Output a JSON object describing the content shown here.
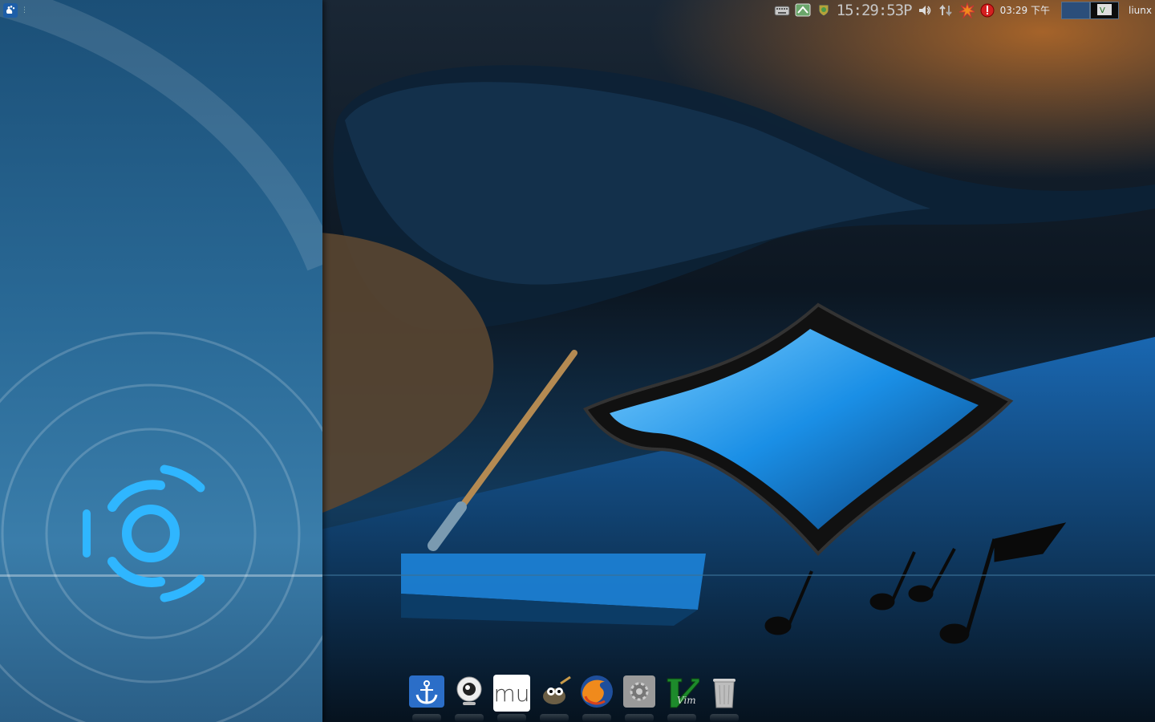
{
  "top_panel": {
    "tray_icons": [
      "keyboard-icon",
      "network-manager-icon",
      "shield-update-icon"
    ],
    "digital_clock": "15:29:53P",
    "status_icons": [
      "volume-icon",
      "network-arrows-icon",
      "starburst-notification-icon",
      "red-alert-gear-icon"
    ],
    "clock_text": "03:29 下午",
    "workspaces": [
      "workspace-1",
      "workspace-2"
    ],
    "username": "liunx"
  },
  "dock": {
    "items": [
      {
        "name": "anchor-launcher",
        "icon": "anchor-icon"
      },
      {
        "name": "webcam-app",
        "icon": "webcam-icon"
      },
      {
        "name": "musescore-app",
        "icon": "mu-icon",
        "label": "mu"
      },
      {
        "name": "gimp-app",
        "icon": "gimp-icon"
      },
      {
        "name": "firefox-app",
        "icon": "firefox-icon"
      },
      {
        "name": "system-settings",
        "icon": "settings-gear-icon"
      },
      {
        "name": "vim-app",
        "icon": "vim-icon",
        "label": "Vim"
      },
      {
        "name": "trash",
        "icon": "trash-icon"
      }
    ]
  },
  "colors": {
    "accent_blue": "#1ea0ff",
    "panel_text": "#e8eef5",
    "wallpaper_left": "#2a6a97",
    "wallpaper_orange": "#be6e28"
  }
}
